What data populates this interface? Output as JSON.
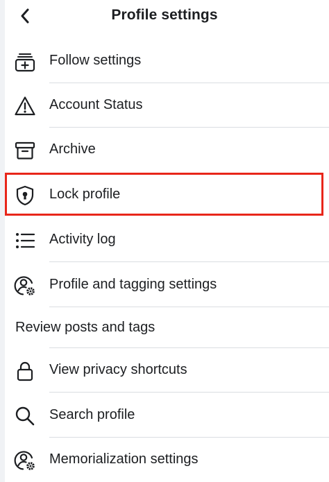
{
  "header": {
    "title": "Profile settings",
    "back_icon": "chevron-left-icon"
  },
  "menu": {
    "follow_settings": {
      "label": "Follow settings",
      "icon": "follow-icon"
    },
    "account_status": {
      "label": "Account Status",
      "icon": "warning-icon"
    },
    "archive": {
      "label": "Archive",
      "icon": "archive-icon"
    },
    "lock_profile": {
      "label": "Lock profile",
      "icon": "shield-lock-icon"
    },
    "activity_log": {
      "label": "Activity log",
      "icon": "list-icon"
    },
    "profile_tagging": {
      "label": "Profile and tagging settings",
      "icon": "user-gear-icon"
    },
    "review_posts": {
      "label": "Review posts and tags"
    },
    "privacy_shortcuts": {
      "label": "View privacy shortcuts",
      "icon": "lock-icon"
    },
    "search_profile": {
      "label": "Search profile",
      "icon": "search-icon"
    },
    "memorialization": {
      "label": "Memorialization settings",
      "icon": "user-gear-icon"
    }
  },
  "highlight": {
    "target": "lock_profile",
    "color": "#e8261a"
  }
}
